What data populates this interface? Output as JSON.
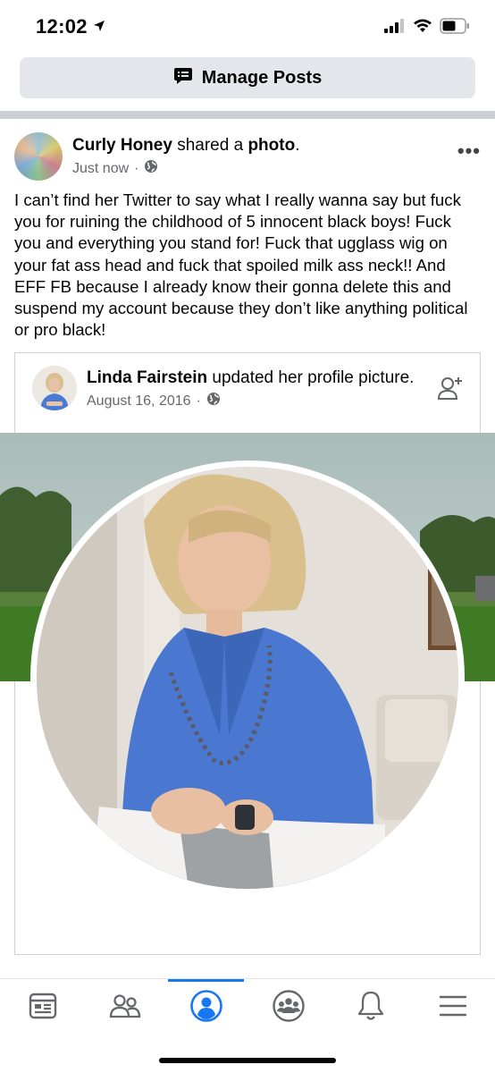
{
  "status_bar": {
    "time": "12:02"
  },
  "manage": {
    "label": "Manage Posts",
    "icon": "chat-list-icon"
  },
  "post": {
    "author": "Curly Honey",
    "action_prefix": "shared a",
    "action_object": "photo",
    "action_suffix": ".",
    "time": "Just now",
    "privacy_icon": "globe-icon",
    "text": "I can’t find her Twitter to say what I really wanna say but fuck you for ruining the childhood of 5 innocent black boys! Fuck you and everything you stand for! Fuck that ugglass wig on your fat ass head and fuck that spoiled milk ass neck!! And EFF FB because I already know their gonna delete this and suspend my account because they don’t like anything political or pro black!"
  },
  "shared": {
    "author": "Linda Fairstein",
    "action": "updated her profile picture.",
    "date": "August 16, 2016",
    "privacy_icon": "globe-icon"
  },
  "nav": {
    "items": [
      "news-feed-icon",
      "friends-icon",
      "profile-icon",
      "groups-icon",
      "notifications-icon",
      "menu-icon"
    ],
    "active": "profile-icon",
    "accent": "#1877f2"
  }
}
